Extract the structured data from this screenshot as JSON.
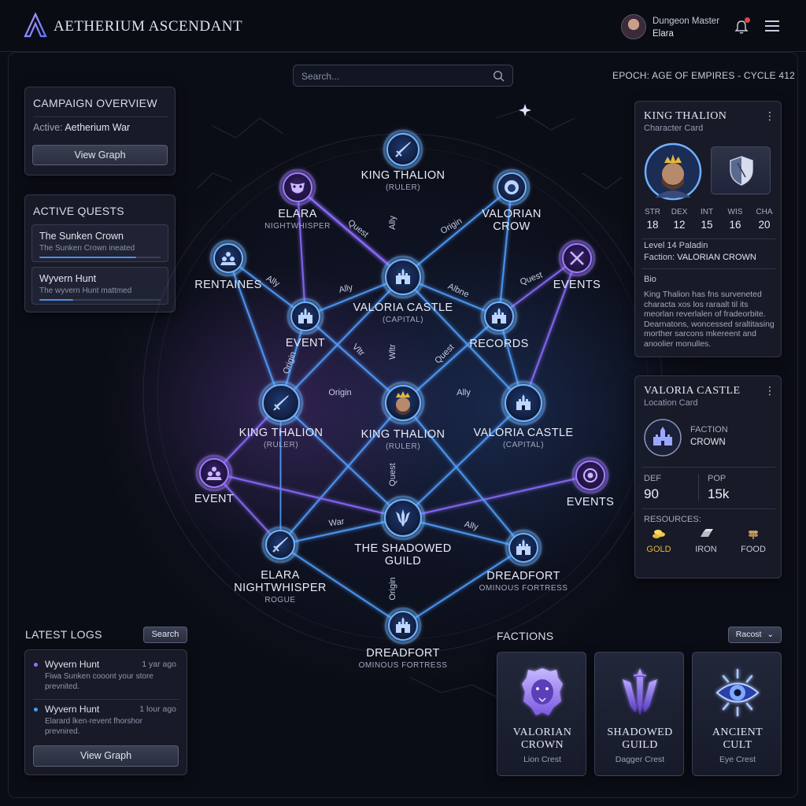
{
  "header": {
    "app_title": "AETHERIUM ASCENDANT",
    "user_role": "Dungeon Master",
    "user_name": "Elara"
  },
  "search": {
    "placeholder": "Search..."
  },
  "epoch": "EPOCH: AGE OF EMPIRES - CYCLE 412",
  "campaign": {
    "title": "CAMPAIGN OVERVIEW",
    "active_label": "Active:",
    "active_value": "Aetherium War",
    "button": "View Graph"
  },
  "quests": {
    "title": "ACTIVE QUESTS",
    "items": [
      {
        "title": "The Sunken Crown",
        "status": "The Sunken Crown ineated",
        "progress": 0.8
      },
      {
        "title": "Wyvern Hunt",
        "status": "The wyvern Hunt mattmed",
        "progress": 0.28
      }
    ]
  },
  "logs": {
    "title": "LATEST LOGS",
    "search_button": "Search",
    "items": [
      {
        "title": "Wyvern Hunt",
        "when": "1 yar ago",
        "desc": "Fiwa Sunken cooont your store prevnited.",
        "color": "#9b6bff"
      },
      {
        "title": "Wyvern Hunt",
        "when": "1 lour ago",
        "desc": "Elarard lken·revent fhorshor prevnired.",
        "color": "#3fa0ff"
      }
    ],
    "button": "View Graph"
  },
  "graph": {
    "nodes": [
      {
        "id": "top-king",
        "title": "KING THALION",
        "sub": "(RULER)",
        "icon": "sword-icon"
      },
      {
        "id": "elara-top",
        "title": "ELARA",
        "sub": "NIGHTWHISPER",
        "icon": "mask-icon"
      },
      {
        "id": "valorian-crow",
        "title": "VALORIAN",
        "sub2": "CROW",
        "icon": "lion-icon"
      },
      {
        "id": "rentaines",
        "title": "RENTAINES",
        "icon": "pawns-icon"
      },
      {
        "id": "events-tr",
        "title": "EVENTS",
        "icon": "swords-icon"
      },
      {
        "id": "valoria-castle-top",
        "title": "VALORIA CASTLE",
        "sub": "(CAPITAL)",
        "icon": "castle-icon"
      },
      {
        "id": "event-l",
        "title": "EVENT",
        "icon": "temple-icon"
      },
      {
        "id": "records",
        "title": "RECORDS",
        "icon": "gate-icon"
      },
      {
        "id": "king-left",
        "title": "KING THALION",
        "sub": "(RULER)",
        "icon": "sword-icon"
      },
      {
        "id": "king-center",
        "title": "KING THALION",
        "sub": "(RULER)",
        "icon": "king-portrait-icon"
      },
      {
        "id": "valoria-castle-right",
        "title": "VALORIA CASTLE",
        "sub": "(CAPITAL)",
        "icon": "castle-icon"
      },
      {
        "id": "event-bl",
        "title": "EVENT",
        "icon": "group-icon"
      },
      {
        "id": "events-br",
        "title": "EVENTS",
        "icon": "orb-icon"
      },
      {
        "id": "shadowed-guild",
        "title": "THE SHADOWED",
        "sub2": "GUILD",
        "icon": "daggers-icon"
      },
      {
        "id": "elara-bottom",
        "title": "ELARA",
        "sub2": "NIGHTWHISPER",
        "sub": "ROGUE",
        "icon": "dagger-icon"
      },
      {
        "id": "dreadfort-right",
        "title": "DREADFORT",
        "sub": "OMINOUS FORTRESS",
        "icon": "tower-icon"
      },
      {
        "id": "dreadfort-bottom",
        "title": "DREADFORT",
        "sub": "OMINOUS FORTRESS",
        "icon": "tower-icon"
      }
    ],
    "edge_labels": [
      "Quest",
      "Ally",
      "Origin",
      "Ally",
      "Ally",
      "Quest",
      "Origin",
      "Vltr",
      "Wltr",
      "Quest",
      "Albne",
      "Origin",
      "Ally",
      "War",
      "Ally",
      "Quest",
      "Origin",
      "Ally"
    ]
  },
  "character_card": {
    "title": "KING THALION",
    "subtitle": "Character Card",
    "stats": [
      {
        "k": "STR",
        "v": "18"
      },
      {
        "k": "DEX",
        "v": "12"
      },
      {
        "k": "INT",
        "v": "15"
      },
      {
        "k": "WIS",
        "v": "16"
      },
      {
        "k": "CHA",
        "v": "20"
      }
    ],
    "level": "Level 14 Paladin",
    "faction_label": "Faction:",
    "faction_value": "VALORIAN CROWN",
    "bio_label": "Bio",
    "bio": "King Thalion has fns surveneted characta xos los raraalt til its meorlan reverlalen of fradeorbite. Dearnatons, woncessed sraltitasing morther sarcons mkereent and anoolier monulles."
  },
  "location_card": {
    "title": "VALORIA CASTLE",
    "subtitle": "Location Card",
    "faction_label": "FACTION",
    "faction_value": "CROWN",
    "def_label": "DEF",
    "def_value": "90",
    "pop_label": "POP",
    "pop_value": "15k",
    "resources_label": "RESOURCES:",
    "resources": [
      {
        "name": "GOLD",
        "color": "#e2b83a",
        "icon": "gold-icon"
      },
      {
        "name": "IRON",
        "color": "#b9bcc6",
        "icon": "iron-icon"
      },
      {
        "name": "FOOD",
        "color": "#c9a36a",
        "icon": "food-icon"
      }
    ]
  },
  "factions": {
    "title": "FACTIONS",
    "sort": "Racost",
    "items": [
      {
        "name_l1": "VALORIAN",
        "name_l2": "CROWN",
        "crest": "Lion Crest",
        "icon": "lion-crest-icon"
      },
      {
        "name_l1": "SHADOWED",
        "name_l2": "GUILD",
        "crest": "Dagger Crest",
        "icon": "dagger-crest-icon"
      },
      {
        "name_l1": "ANCIENT",
        "name_l2": "CULT",
        "crest": "Eye Crest",
        "icon": "eye-crest-icon"
      }
    ]
  },
  "colors": {
    "accent": "#5aa8ff",
    "purple": "#9a6bff",
    "panel": "#1a1d2a"
  }
}
